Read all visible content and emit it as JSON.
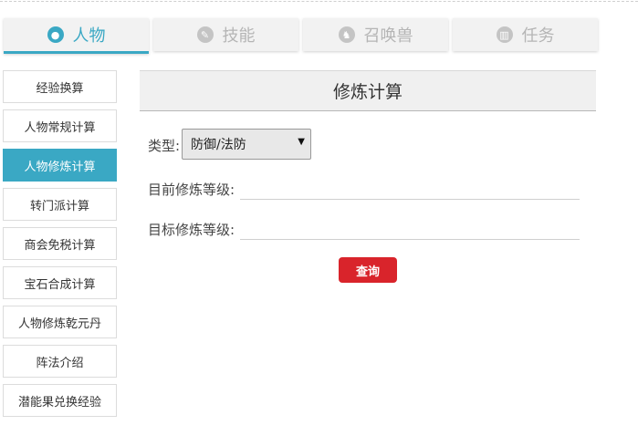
{
  "tabs": [
    {
      "label": "人物",
      "icon": "person-icon",
      "active": true
    },
    {
      "label": "技能",
      "icon": "wrench-icon",
      "active": false
    },
    {
      "label": "召唤兽",
      "icon": "beast-icon",
      "active": false
    },
    {
      "label": "任务",
      "icon": "book-icon",
      "active": false
    }
  ],
  "sidebar": {
    "items": [
      {
        "label": "经验换算"
      },
      {
        "label": "人物常规计算"
      },
      {
        "label": "人物修炼计算",
        "active": true
      },
      {
        "label": "转门派计算"
      },
      {
        "label": "商会免税计算"
      },
      {
        "label": "宝石合成计算"
      },
      {
        "label": "人物修炼乾元丹"
      },
      {
        "label": "阵法介绍"
      },
      {
        "label": "潜能果兑换经验"
      }
    ]
  },
  "main": {
    "title": "修炼计算",
    "type_label": "类型:",
    "type_value": "防御/法防",
    "current_label": "目前修炼等级:",
    "target_label": "目标修炼等级:",
    "query_label": "查询"
  },
  "colors": {
    "accent": "#3aa8c4",
    "button": "#d9242b"
  }
}
